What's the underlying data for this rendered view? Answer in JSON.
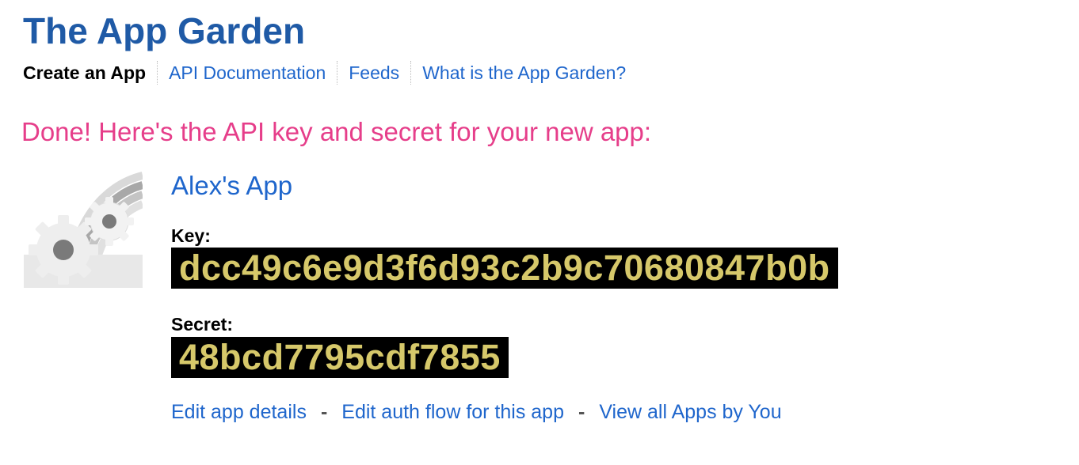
{
  "header": {
    "title": "The App Garden"
  },
  "subnav": {
    "items": [
      {
        "label": "Create an App",
        "active": true
      },
      {
        "label": "API Documentation",
        "active": false
      },
      {
        "label": "Feeds",
        "active": false
      },
      {
        "label": "What is the App Garden?",
        "active": false
      }
    ]
  },
  "main": {
    "done_heading": "Done! Here's the API key and secret for your new app:",
    "app": {
      "icon": "app-gears-rainbow-icon",
      "name": "Alex's App",
      "key_label": "Key:",
      "key_value": "dcc49c6e9d3f6d93c2b9c70680847b0b",
      "secret_label": "Secret:",
      "secret_value": "48bcd7795cdf7855"
    },
    "actions": {
      "edit_details": "Edit app details",
      "edit_auth": "Edit auth flow for this app",
      "view_all": "View all Apps by You",
      "separator": "-"
    }
  },
  "colors": {
    "title": "#1f5aa6",
    "link": "#1f66cc",
    "done_heading": "#e63e8a",
    "code_bg": "#000000",
    "code_text": "#d6c86a"
  }
}
